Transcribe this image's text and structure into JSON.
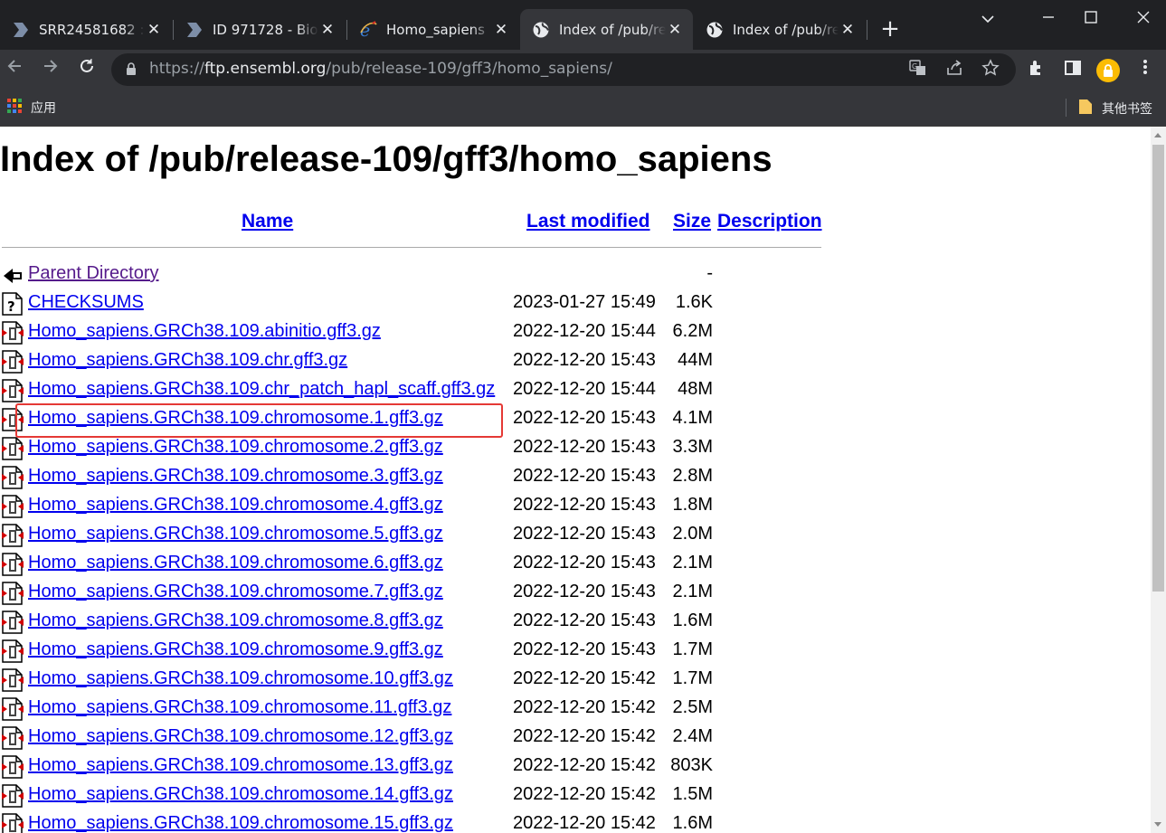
{
  "browser": {
    "tabs": [
      {
        "title": "SRR24581682 :",
        "icon": "document-arrow-icon",
        "active": false
      },
      {
        "title": "ID 971728 - Bio",
        "icon": "document-arrow-icon",
        "active": false
      },
      {
        "title": "Homo_sapiens",
        "icon": "internet-explorer-icon",
        "active": false
      },
      {
        "title": "Index of /pub/re",
        "icon": "globe-icon",
        "active": true
      },
      {
        "title": "Index of /pub/re",
        "icon": "globe-icon",
        "active": false
      }
    ],
    "address": {
      "scheme": "https://",
      "host": "ftp.ensembl.org",
      "path": "/pub/release-109/gff3/homo_sapiens/"
    },
    "bookmarks": {
      "apps_label": "应用",
      "other_label": "其他书签"
    },
    "colors": {
      "tab_strip": "#202124",
      "toolbar": "#35363a",
      "profile": "#fbbc04"
    }
  },
  "page": {
    "title": "Index of /pub/release-109/gff3/homo_sapiens",
    "columns": {
      "name": "Name",
      "modified": "Last modified",
      "size": "Size",
      "description": "Description"
    },
    "highlight_color": "#e53935",
    "highlighted_entry": "Homo_sapiens.GRCh38.109.chromosome.1.gff3.gz",
    "entries": [
      {
        "name": "Parent Directory",
        "date": "",
        "size": "-",
        "icon": "back-arrow-icon",
        "visited": true
      },
      {
        "name": "CHECKSUMS",
        "date": "2023-01-27 15:49",
        "size": "1.6K",
        "icon": "unknown-file-icon",
        "visited": false
      },
      {
        "name": "Homo_sapiens.GRCh38.109.abinitio.gff3.gz",
        "date": "2022-12-20 15:44",
        "size": "6.2M",
        "icon": "compressed-file-icon",
        "visited": false
      },
      {
        "name": "Homo_sapiens.GRCh38.109.chr.gff3.gz",
        "date": "2022-12-20 15:43",
        "size": "44M",
        "icon": "compressed-file-icon",
        "visited": false
      },
      {
        "name": "Homo_sapiens.GRCh38.109.chr_patch_hapl_scaff.gff3.gz",
        "date": "2022-12-20 15:44",
        "size": "48M",
        "icon": "compressed-file-icon",
        "visited": false
      },
      {
        "name": "Homo_sapiens.GRCh38.109.chromosome.1.gff3.gz",
        "date": "2022-12-20 15:43",
        "size": "4.1M",
        "icon": "compressed-file-icon",
        "visited": false
      },
      {
        "name": "Homo_sapiens.GRCh38.109.chromosome.2.gff3.gz",
        "date": "2022-12-20 15:43",
        "size": "3.3M",
        "icon": "compressed-file-icon",
        "visited": false
      },
      {
        "name": "Homo_sapiens.GRCh38.109.chromosome.3.gff3.gz",
        "date": "2022-12-20 15:43",
        "size": "2.8M",
        "icon": "compressed-file-icon",
        "visited": false
      },
      {
        "name": "Homo_sapiens.GRCh38.109.chromosome.4.gff3.gz",
        "date": "2022-12-20 15:43",
        "size": "1.8M",
        "icon": "compressed-file-icon",
        "visited": false
      },
      {
        "name": "Homo_sapiens.GRCh38.109.chromosome.5.gff3.gz",
        "date": "2022-12-20 15:43",
        "size": "2.0M",
        "icon": "compressed-file-icon",
        "visited": false
      },
      {
        "name": "Homo_sapiens.GRCh38.109.chromosome.6.gff3.gz",
        "date": "2022-12-20 15:43",
        "size": "2.1M",
        "icon": "compressed-file-icon",
        "visited": false
      },
      {
        "name": "Homo_sapiens.GRCh38.109.chromosome.7.gff3.gz",
        "date": "2022-12-20 15:43",
        "size": "2.1M",
        "icon": "compressed-file-icon",
        "visited": false
      },
      {
        "name": "Homo_sapiens.GRCh38.109.chromosome.8.gff3.gz",
        "date": "2022-12-20 15:43",
        "size": "1.6M",
        "icon": "compressed-file-icon",
        "visited": false
      },
      {
        "name": "Homo_sapiens.GRCh38.109.chromosome.9.gff3.gz",
        "date": "2022-12-20 15:43",
        "size": "1.7M",
        "icon": "compressed-file-icon",
        "visited": false
      },
      {
        "name": "Homo_sapiens.GRCh38.109.chromosome.10.gff3.gz",
        "date": "2022-12-20 15:42",
        "size": "1.7M",
        "icon": "compressed-file-icon",
        "visited": false
      },
      {
        "name": "Homo_sapiens.GRCh38.109.chromosome.11.gff3.gz",
        "date": "2022-12-20 15:42",
        "size": "2.5M",
        "icon": "compressed-file-icon",
        "visited": false
      },
      {
        "name": "Homo_sapiens.GRCh38.109.chromosome.12.gff3.gz",
        "date": "2022-12-20 15:42",
        "size": "2.4M",
        "icon": "compressed-file-icon",
        "visited": false
      },
      {
        "name": "Homo_sapiens.GRCh38.109.chromosome.13.gff3.gz",
        "date": "2022-12-20 15:42",
        "size": "803K",
        "icon": "compressed-file-icon",
        "visited": false
      },
      {
        "name": "Homo_sapiens.GRCh38.109.chromosome.14.gff3.gz",
        "date": "2022-12-20 15:42",
        "size": "1.5M",
        "icon": "compressed-file-icon",
        "visited": false
      },
      {
        "name": "Homo_sapiens.GRCh38.109.chromosome.15.gff3.gz",
        "date": "2022-12-20 15:42",
        "size": "1.6M",
        "icon": "compressed-file-icon",
        "visited": false
      }
    ]
  }
}
